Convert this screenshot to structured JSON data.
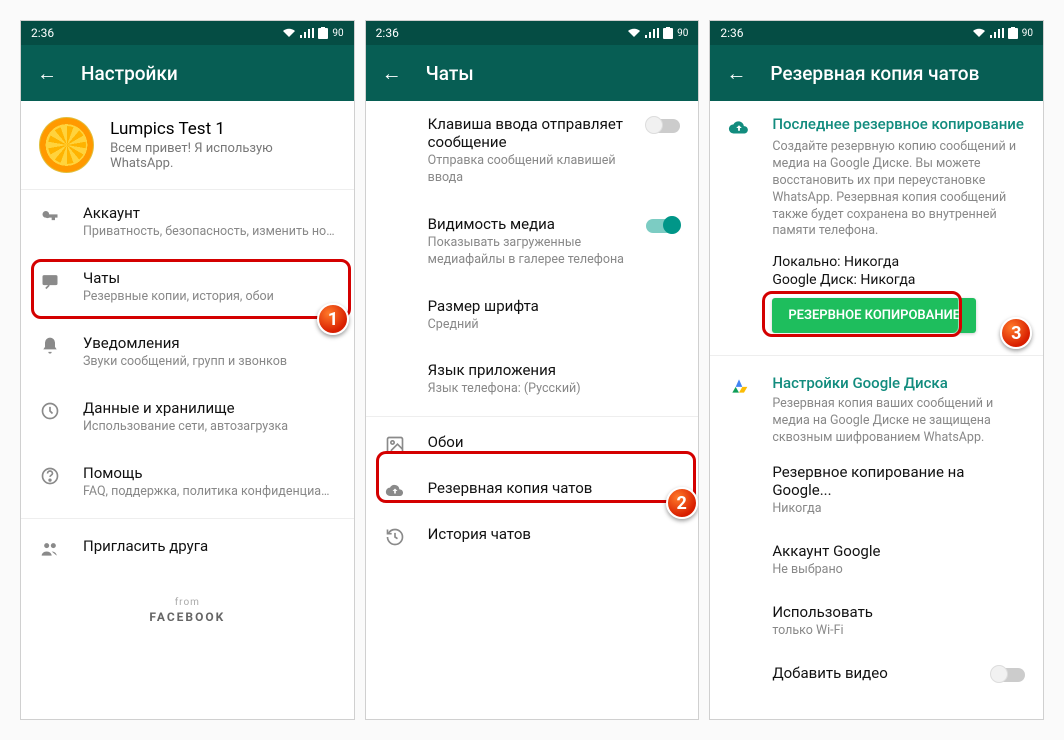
{
  "status": {
    "time": "2:36",
    "battery": "90"
  },
  "screen1": {
    "title": "Настройки",
    "profile": {
      "name": "Lumpics Test 1",
      "status": "Всем привет! Я использую WhatsApp."
    },
    "items": {
      "account": {
        "title": "Аккаунт",
        "sub": "Приватность, безопасность, изменить номер"
      },
      "chats": {
        "title": "Чаты",
        "sub": "Резервные копии, история, обои"
      },
      "notif": {
        "title": "Уведомления",
        "sub": "Звуки сообщений, групп и звонков"
      },
      "data": {
        "title": "Данные и хранилище",
        "sub": "Использование сети, автозагрузка"
      },
      "help": {
        "title": "Помощь",
        "sub": "FAQ, поддержка, политика конфиденциаль..."
      },
      "invite": {
        "title": "Пригласить друга"
      }
    },
    "from": "from",
    "facebook": "FACEBOOK"
  },
  "screen2": {
    "title": "Чаты",
    "items": {
      "enter": {
        "title": "Клавиша ввода отправляет сообщение",
        "sub": "Отправка сообщений клавишей ввода"
      },
      "media": {
        "title": "Видимость медиа",
        "sub": "Показывать загруженные медиафайлы в галерее телефона"
      },
      "font": {
        "title": "Размер шрифта",
        "sub": "Средний"
      },
      "lang": {
        "title": "Язык приложения",
        "sub": "Язык телефона: (Русский)"
      },
      "wall": {
        "title": "Обои"
      },
      "backup": {
        "title": "Резервная копия чатов"
      },
      "history": {
        "title": "История чатов"
      }
    }
  },
  "screen3": {
    "title": "Резервная копия чатов",
    "last": {
      "heading": "Последнее резервное копирование",
      "desc": "Создайте резервную копию сообщений и медиа на Google Диске. Вы можете восстановить их при переустановке WhatsApp. Резервная копия сообщений также будет сохранена во внутренней памяти телефона.",
      "local": "Локально: Никогда",
      "gdrive": "Google Диск: Никогда"
    },
    "button": "РЕЗЕРВНОЕ КОПИРОВАНИЕ",
    "gd": {
      "heading": "Настройки Google Диска",
      "desc": "Резервная копия ваших сообщений и медиа на Google Диске не защищена сквозным шифрованием WhatsApp.",
      "freq": {
        "title": "Резервное копирование на Google...",
        "sub": "Никогда"
      },
      "acct": {
        "title": "Аккаунт Google",
        "sub": "Не выбрано"
      },
      "net": {
        "title": "Использовать",
        "sub": "только Wi-Fi"
      },
      "video": {
        "title": "Добавить видео"
      }
    }
  },
  "steps": {
    "1": "1",
    "2": "2",
    "3": "3"
  }
}
